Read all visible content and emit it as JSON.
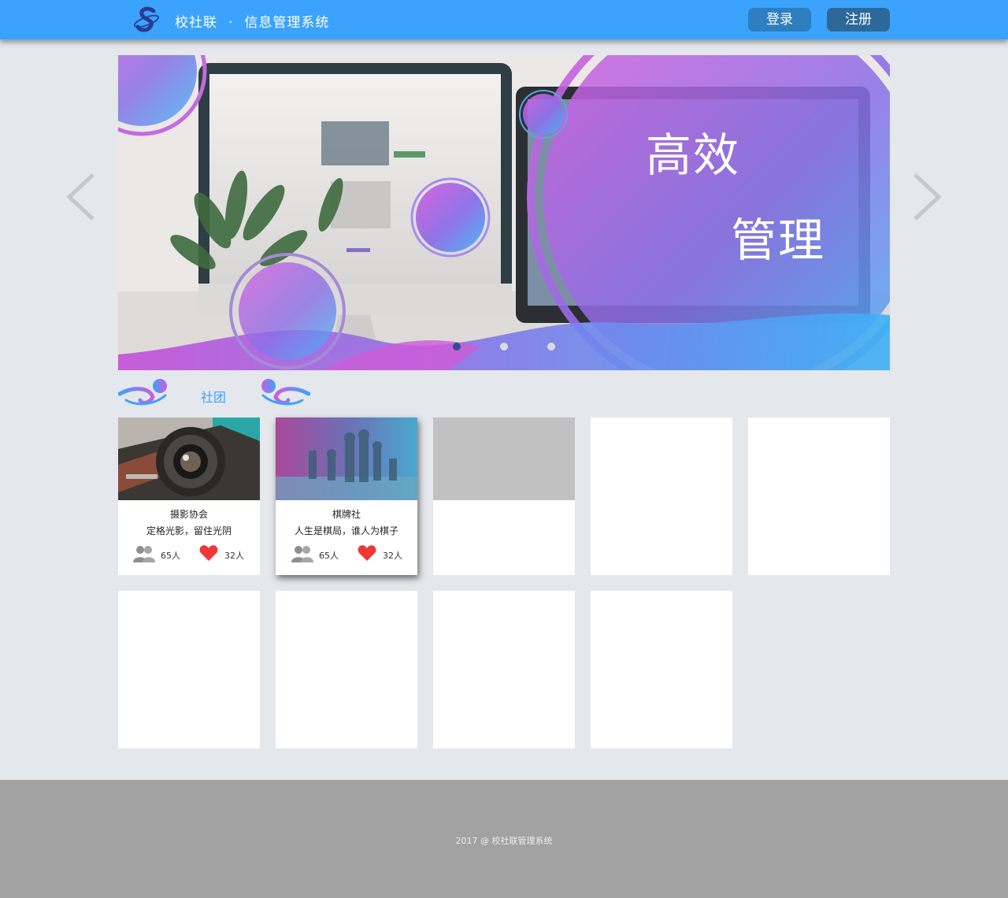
{
  "header": {
    "app_name": "校社联",
    "separator": "·",
    "system_name": "信息管理系统",
    "login_label": "登录",
    "register_label": "注册"
  },
  "banner": {
    "slogan_line1": "高效",
    "slogan_line2": "管理",
    "slide_count": 3,
    "active_slide": 1
  },
  "section": {
    "title": "社团"
  },
  "clubs": [
    {
      "name": "摄影协会",
      "description": "定格光影，留住光阴",
      "members": "65人",
      "likes": "32人",
      "image": "camera-photo"
    },
    {
      "name": "棋牌社",
      "description": "人生是棋局，谁人为棋子",
      "members": "65人",
      "likes": "32人",
      "image": "chess-photo"
    }
  ],
  "footer": {
    "copyright": "2017 @ 校社联管理系统"
  },
  "colors": {
    "header": "#3ba3fb",
    "login_button": "#2e7fc0",
    "register_button": "#2c6899",
    "page_background": "#e4e7ec",
    "footer": "#a2a2a2",
    "accent_purple": "#c95fe0",
    "like_red": "#ef3737"
  }
}
